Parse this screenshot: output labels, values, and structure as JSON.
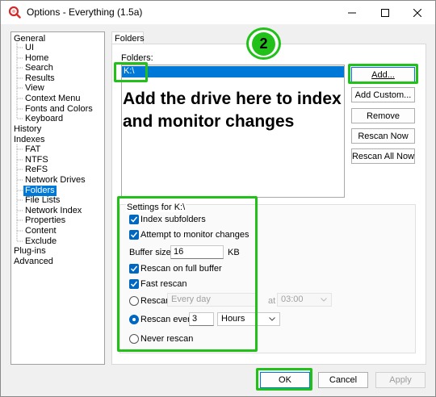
{
  "window": {
    "title": "Options - Everything (1.5a)",
    "minimize_icon": "minimize-icon",
    "maximize_icon": "maximize-icon",
    "close_icon": "close-icon"
  },
  "tree": {
    "items": [
      {
        "label": "General"
      },
      {
        "label": "UI"
      },
      {
        "label": "Home"
      },
      {
        "label": "Search"
      },
      {
        "label": "Results"
      },
      {
        "label": "View"
      },
      {
        "label": "Context Menu"
      },
      {
        "label": "Fonts and Colors"
      },
      {
        "label": "Keyboard"
      },
      {
        "label": "History"
      },
      {
        "label": "Indexes"
      },
      {
        "label": "FAT"
      },
      {
        "label": "NTFS"
      },
      {
        "label": "ReFS"
      },
      {
        "label": "Network Drives"
      },
      {
        "label": "Folders"
      },
      {
        "label": "File Lists"
      },
      {
        "label": "Network Index"
      },
      {
        "label": "Properties"
      },
      {
        "label": "Content"
      },
      {
        "label": "Exclude"
      },
      {
        "label": "Plug-ins"
      },
      {
        "label": "Advanced"
      }
    ],
    "selected": "Folders"
  },
  "panel": {
    "tab_label": "Folders",
    "folders_label": "Folders:",
    "folders": [
      "K:\\"
    ],
    "annotation": "Add the drive here to index and monitor changes",
    "step_badge": "2"
  },
  "buttons": {
    "add": "Add...",
    "add_custom": "Add Custom...",
    "remove": "Remove",
    "rescan_now": "Rescan Now",
    "rescan_all_now": "Rescan All Now"
  },
  "settings": {
    "group_label": "Settings for K:\\",
    "index_subfolders": {
      "label": "Index subfolders",
      "checked": true
    },
    "monitor_changes": {
      "label": "Attempt to monitor changes",
      "checked": true
    },
    "buffer_size_label": "Buffer size:",
    "buffer_size_value": "16",
    "buffer_size_unit": "KB",
    "rescan_full_buffer": {
      "label": "Rescan on full buffer",
      "checked": true
    },
    "fast_rescan": {
      "label": "Fast rescan",
      "checked": true
    },
    "rescan_label": "Rescan",
    "rescan_schedule": "Every day",
    "at_label": "at",
    "rescan_time": "03:00",
    "rescan_every_label": "Rescan every",
    "rescan_every_value": "3",
    "rescan_every_unit": "Hours",
    "never_rescan_label": "Never rescan",
    "selected_rescan_mode": "Rescan every"
  },
  "footer": {
    "ok": "OK",
    "cancel": "Cancel",
    "apply": "Apply"
  },
  "colors": {
    "highlight_green": "#22c11a",
    "selection_blue": "#0078d7",
    "checkbox_blue": "#0067c0"
  }
}
